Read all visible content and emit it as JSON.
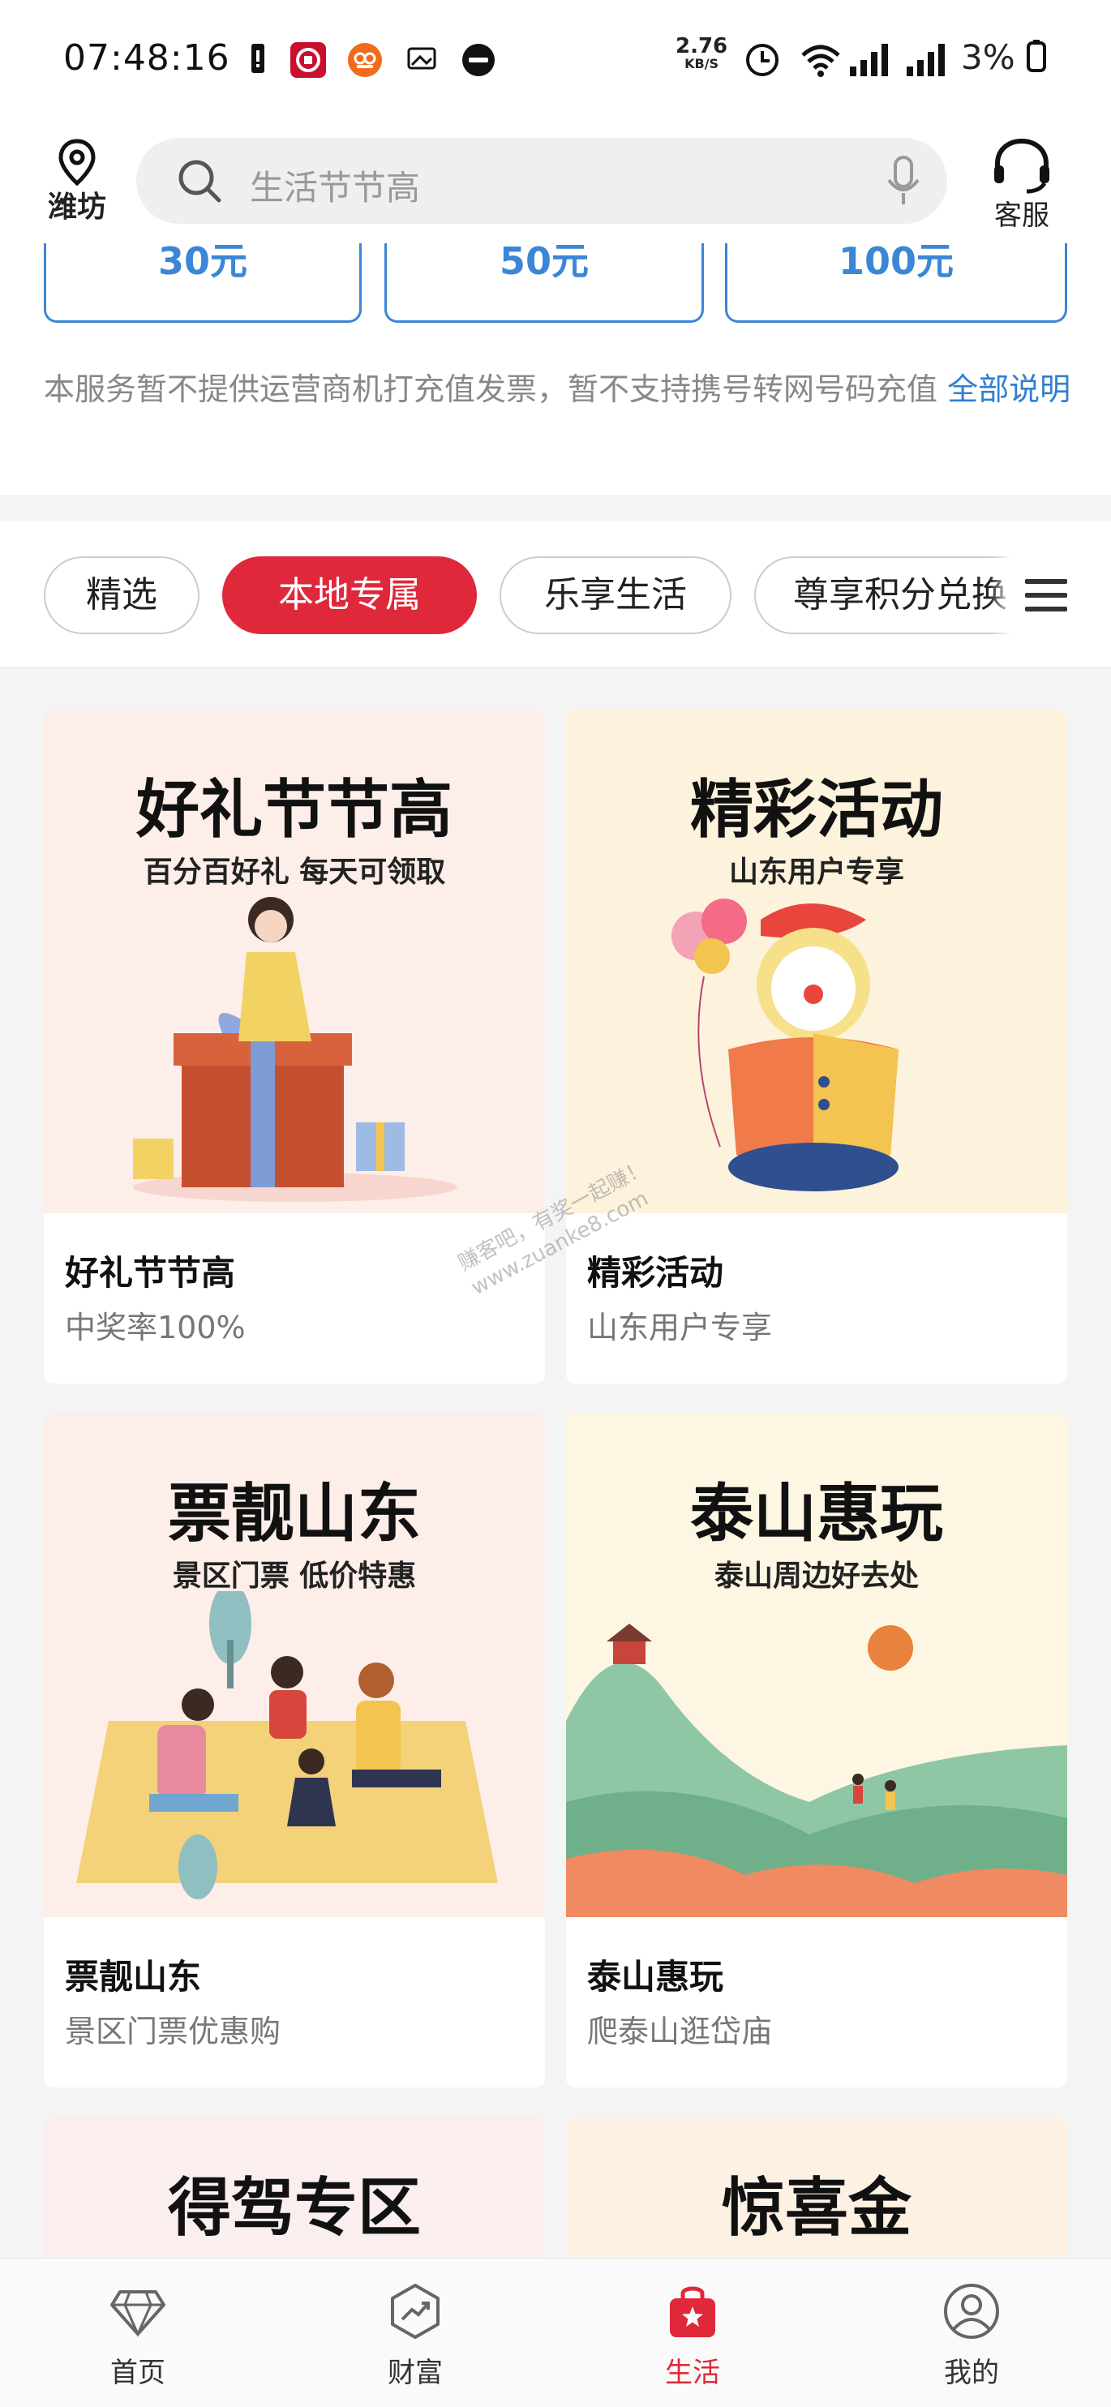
{
  "status_bar": {
    "time": "07:48:16",
    "speed_value": "2.76",
    "speed_unit": "KB/S",
    "battery": "3%"
  },
  "header": {
    "location": "潍坊",
    "search_placeholder": "生活节节高",
    "service_label": "客服"
  },
  "recharge": {
    "amounts": [
      "30元",
      "50元",
      "100元"
    ],
    "notice": "本服务暂不提供运营商机打充值发票，暂不支持携号转网号码充值",
    "notice_link": "全部说明"
  },
  "tabs": [
    "精选",
    "本地专属",
    "乐享生活",
    "尊享积分兑换"
  ],
  "active_tab": "本地专属",
  "cards": [
    {
      "hero_title": "好礼节节高",
      "hero_subtitle": "百分百好礼 每天可领取",
      "title": "好礼节节高",
      "subtitle": "中奖率100%",
      "bg": "#fdeeea"
    },
    {
      "hero_title": "精彩活动",
      "hero_subtitle": "山东用户专享",
      "title": "精彩活动",
      "subtitle": "山东用户专享",
      "bg": "#fdf2dc"
    },
    {
      "hero_title": "票靓山东",
      "hero_subtitle": "景区门票 低价特惠",
      "title": "票靓山东",
      "subtitle": "景区门票优惠购",
      "bg": "#fdeeea"
    },
    {
      "hero_title": "泰山惠玩",
      "hero_subtitle": "泰山周边好去处",
      "title": "泰山惠玩",
      "subtitle": "爬泰山逛岱庙",
      "bg": "#fcf6e2"
    },
    {
      "hero_title": "得驾专区",
      "bg": "#fbeeee"
    },
    {
      "hero_title": "惊喜金",
      "bg": "#fdf1e3"
    }
  ],
  "watermark": [
    "赚客吧，有奖一起赚！",
    "www.zuanke8.com"
  ],
  "bottom_nav": [
    {
      "label": "首页",
      "icon": "diamond-icon"
    },
    {
      "label": "财富",
      "icon": "chart-trend-icon"
    },
    {
      "label": "生活",
      "icon": "shopping-bag-icon"
    },
    {
      "label": "我的",
      "icon": "user-icon"
    }
  ],
  "active_nav": "生活",
  "colors": {
    "accent_red": "#e0283b",
    "link_blue": "#2f7fd0"
  }
}
